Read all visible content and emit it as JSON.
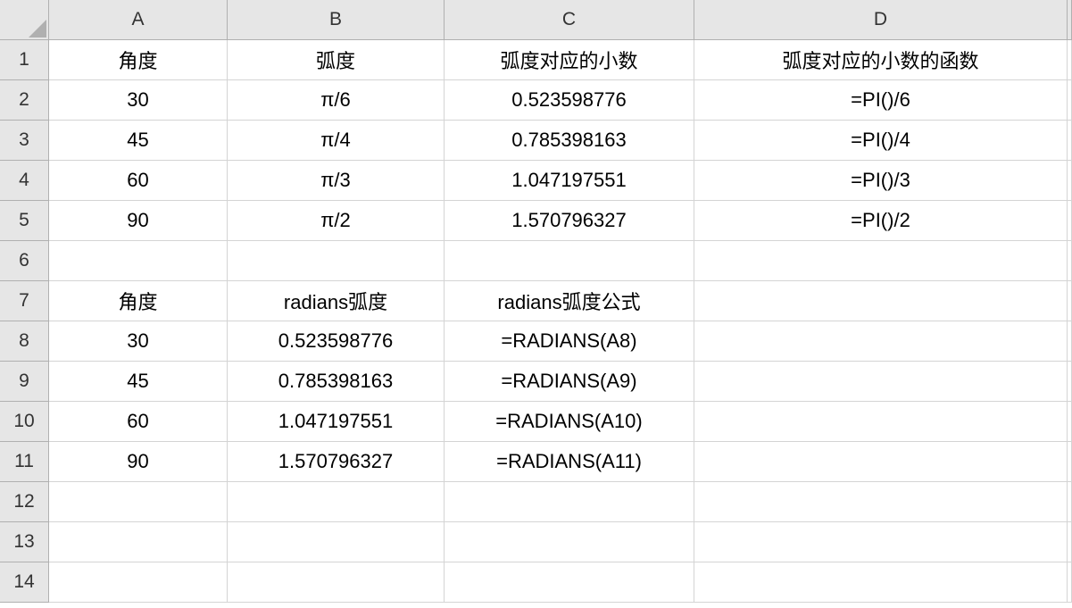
{
  "columns": [
    "A",
    "B",
    "C",
    "D"
  ],
  "rows": [
    "1",
    "2",
    "3",
    "4",
    "5",
    "6",
    "7",
    "8",
    "9",
    "10",
    "11",
    "12",
    "13",
    "14"
  ],
  "cells": {
    "r1": {
      "A": "角度",
      "B": "弧度",
      "C": "弧度对应的小数",
      "D": "弧度对应的小数的函数"
    },
    "r2": {
      "A": "30",
      "B": "π/6",
      "C": "0.523598776",
      "D": "=PI()/6"
    },
    "r3": {
      "A": "45",
      "B": "π/4",
      "C": "0.785398163",
      "D": "=PI()/4"
    },
    "r4": {
      "A": "60",
      "B": "π/3",
      "C": "1.047197551",
      "D": "=PI()/3"
    },
    "r5": {
      "A": "90",
      "B": "π/2",
      "C": "1.570796327",
      "D": "=PI()/2"
    },
    "r6": {
      "A": "",
      "B": "",
      "C": "",
      "D": ""
    },
    "r7": {
      "A": "角度",
      "B": "radians弧度",
      "C": "radians弧度公式",
      "D": ""
    },
    "r8": {
      "A": "30",
      "B": "0.523598776",
      "C": "=RADIANS(A8)",
      "D": ""
    },
    "r9": {
      "A": "45",
      "B": "0.785398163",
      "C": "=RADIANS(A9)",
      "D": ""
    },
    "r10": {
      "A": "60",
      "B": "1.047197551",
      "C": "=RADIANS(A10)",
      "D": ""
    },
    "r11": {
      "A": "90",
      "B": "1.570796327",
      "C": "=RADIANS(A11)",
      "D": ""
    },
    "r12": {
      "A": "",
      "B": "",
      "C": "",
      "D": ""
    },
    "r13": {
      "A": "",
      "B": "",
      "C": "",
      "D": ""
    },
    "r14": {
      "A": "",
      "B": "",
      "C": "",
      "D": ""
    }
  }
}
